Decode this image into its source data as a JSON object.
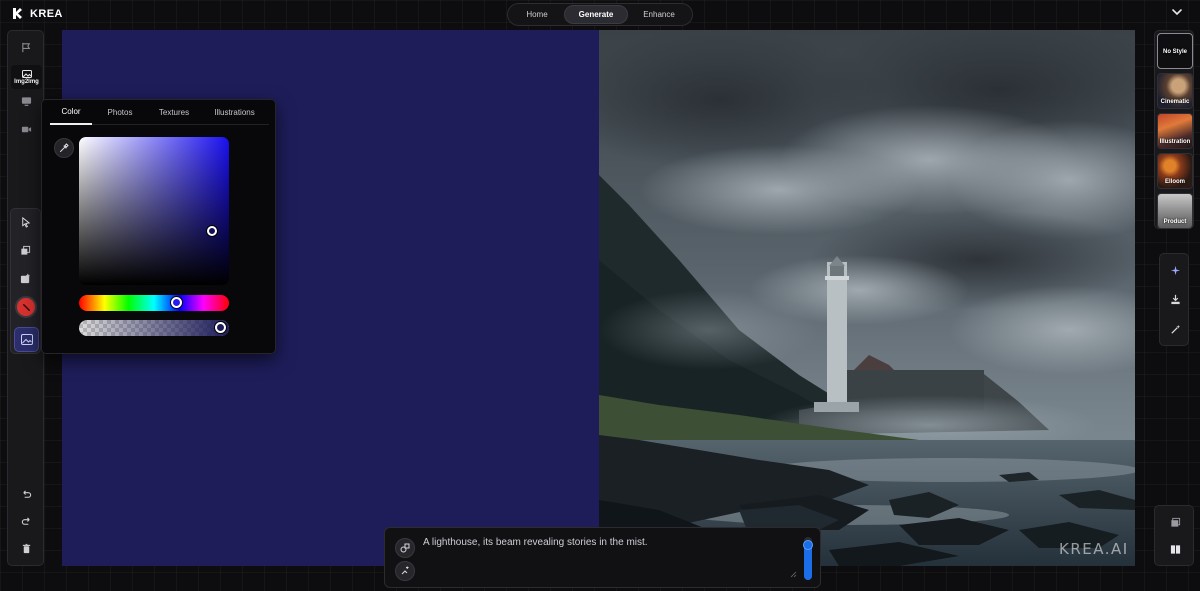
{
  "brand": {
    "name": "KREA"
  },
  "top_nav": {
    "tabs": [
      {
        "label": "Home"
      },
      {
        "label": "Generate"
      },
      {
        "label": "Enhance"
      }
    ],
    "active": "Generate"
  },
  "left_rail": {
    "mode_label": "Img2Img",
    "active_color": "#d8312f",
    "background_color": "#1e1d5a"
  },
  "color_picker": {
    "tabs": [
      {
        "label": "Color"
      },
      {
        "label": "Photos"
      },
      {
        "label": "Textures"
      },
      {
        "label": "Illustrations"
      }
    ],
    "active_tab": "Color",
    "hue": 242,
    "selected_color": "#1e1d5a"
  },
  "styles": [
    {
      "label": "No Style"
    },
    {
      "label": "Cinematic"
    },
    {
      "label": "Illustration"
    },
    {
      "label": "Elloom"
    },
    {
      "label": "Product"
    }
  ],
  "prompt": {
    "text": "A lighthouse, its beam revealing stories in the mist.",
    "strength": 0.9
  },
  "watermark": "KREA.AI",
  "icons": {
    "brand": "krea-logo-icon",
    "nav": "chevron-down-icon",
    "rail_left": [
      "flag-icon",
      "monitor-icon",
      "video-icon",
      "pointer-icon",
      "layers-icon",
      "image-add-icon",
      "undo-icon",
      "redo-icon",
      "trash-icon"
    ],
    "rail_right": [
      "sparkle-icon",
      "download-icon",
      "magic-wand-icon",
      "layers-stack-icon",
      "split-view-icon"
    ]
  }
}
